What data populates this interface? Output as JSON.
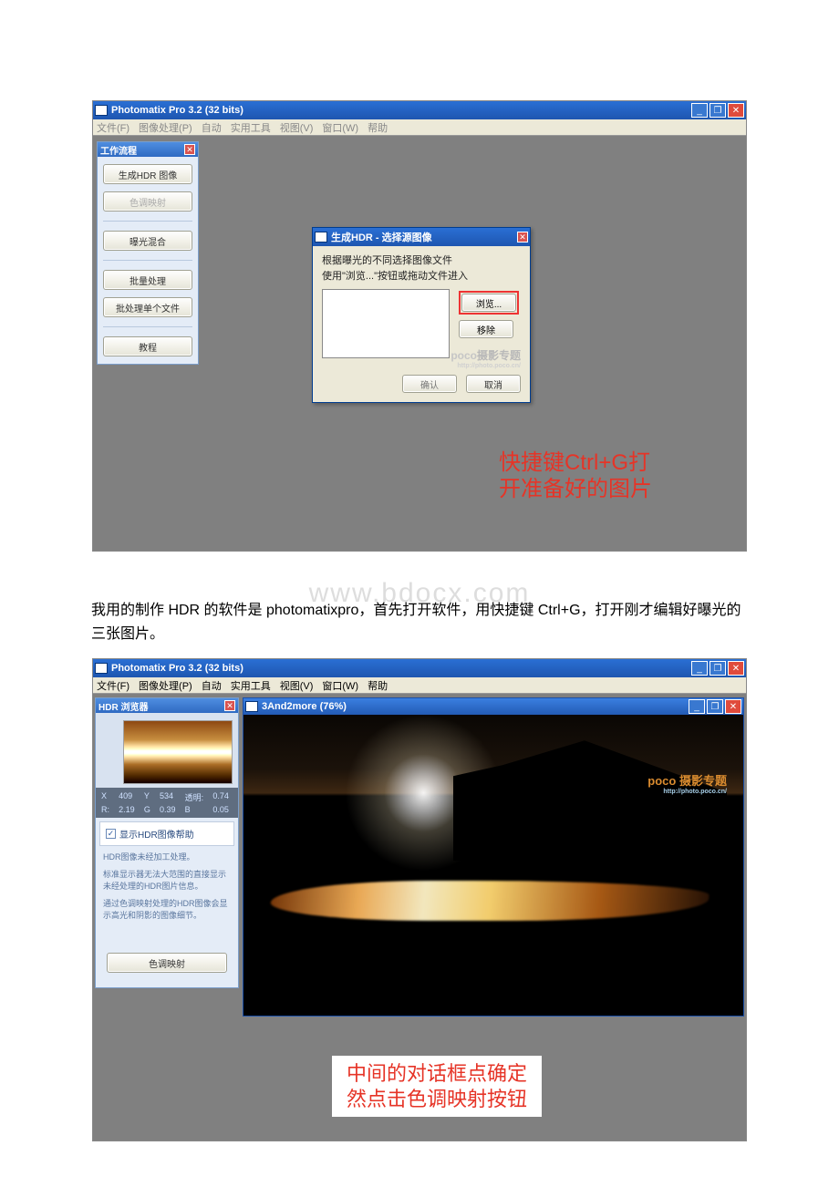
{
  "shot1": {
    "title": "Photomatix Pro 3.2 (32 bits)",
    "menus": [
      "文件(F)",
      "图像处理(P)",
      "自动",
      "实用工具",
      "视图(V)",
      "窗口(W)",
      "帮助"
    ],
    "workflow": {
      "title": "工作流程",
      "btn_generate": "生成HDR 图像",
      "btn_tonemap": "色调映射",
      "btn_exposure": "曝光混合",
      "btn_batch": "批量处理",
      "btn_batchsingle": "批处理单个文件",
      "btn_tutorial": "教程"
    },
    "dialog": {
      "title": "生成HDR - 选择源图像",
      "line1": "根据曝光的不同选择图像文件",
      "line2": "使用\"浏览...\"按钮或拖动文件进入",
      "browse": "浏览...",
      "remove": "移除",
      "ok": "确认",
      "cancel": "取消"
    },
    "poco": "poco",
    "poco_sub": "摄影专题",
    "callout_l1": "快捷键Ctrl+G打",
    "callout_l2": "开准备好的图片"
  },
  "article": {
    "wm": "www.bdocx.com",
    "para": "我用的制作 HDR 的软件是 photomatixpro，首先打开软件，用快捷键 Ctrl+G，打开刚才编辑好曝光的三张图片。"
  },
  "shot2": {
    "title": "Photomatix Pro 3.2 (32 bits)",
    "menus": [
      "文件(F)",
      "图像处理(P)",
      "自动",
      "实用工具",
      "视图(V)",
      "窗口(W)",
      "帮助"
    ],
    "hdr_panel": {
      "title": "HDR 浏览器",
      "info": {
        "X": "X",
        "xv": "409",
        "Y": "Y",
        "yv": "534",
        "tm": "透明:",
        "tmv": "0.74",
        "R": "R:",
        "rv": "2.19",
        "G": "G",
        "gv": "0.39",
        "B": "B",
        "bv": "0.05"
      },
      "chk_label": "显示HDR图像帮助",
      "desc_a": "HDR图像未经加工处理。",
      "desc_b": "标准显示器无法大范围的直接显示未经处理的HDR图片信息。",
      "desc_c": "通过色调映射处理的HDR图像会显示高光和阴影的图像细节。",
      "tonemap_btn": "色调映射"
    },
    "docwin": {
      "title": "3And2more (76%)"
    },
    "poco": "poco",
    "poco_sub": "摄影专题",
    "callout_l1": "中间的对话框点确定",
    "callout_l2": "然点击色调映射按钮"
  }
}
